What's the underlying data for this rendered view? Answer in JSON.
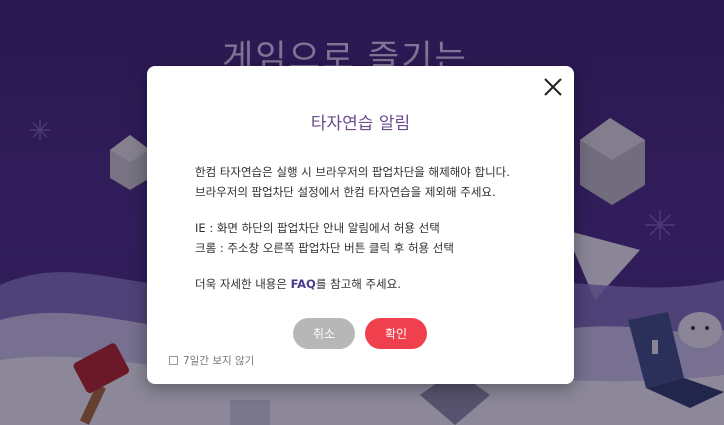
{
  "background": {
    "headline": "게임으로 즐기는"
  },
  "dialog": {
    "title": "타자연습 알림",
    "close_icon": "close-icon",
    "body": {
      "line1": "한컴 타자연습은 실행 시 브라우저의 팝업차단을 해제해야 합니다.",
      "line2": "브라우저의 팝업차단 설정에서 한컴 타자연습을 제외해 주세요.",
      "line3": "IE : 화면 하단의 팝업차단 안내 알림에서 허용 선택",
      "line4": "크롬 : 주소창 오른쪽 팝업차단 버튼 클릭 후 허용 선택",
      "line5_prefix": "더욱 자세한 내용은 ",
      "faq_link": "FAQ",
      "line5_suffix": "를 참고해 주세요."
    },
    "buttons": {
      "cancel": "취소",
      "ok": "확인"
    },
    "checkbox_label": "7일간 보지 않기",
    "colors": {
      "title": "#6a4c8e",
      "ok_button": "#f0404e",
      "cancel_button": "#b7b7b7",
      "faq_link": "#4b3a8c"
    }
  }
}
